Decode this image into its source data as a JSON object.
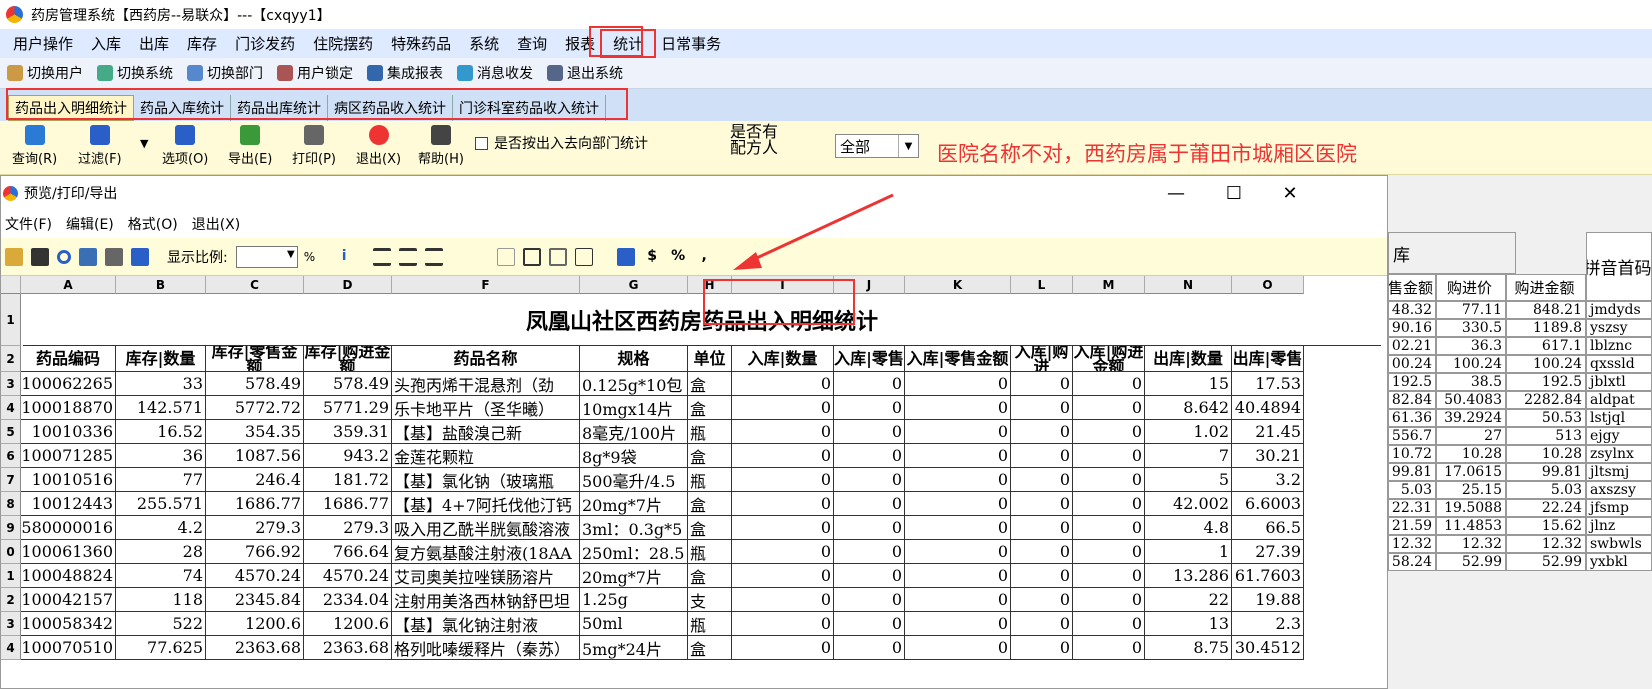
{
  "window_title": "药房管理系统【西药房--易联众】---【cxqyy1】",
  "menu": [
    "用户操作",
    "入库",
    "出库",
    "库存",
    "门诊发药",
    "住院摆药",
    "特殊药品",
    "系统",
    "查询",
    "报表",
    "统计",
    "日常事务"
  ],
  "toolbar": [
    "切换用户",
    "切换系统",
    "切换部门",
    "用户锁定",
    "集成报表",
    "消息收发",
    "退出系统"
  ],
  "tabs": [
    "药品出入明细统计",
    "药品入库统计",
    "药品出库统计",
    "病区药品收入统计",
    "门诊科室药品收入统计"
  ],
  "actions": [
    "查询(R)",
    "过滤(F)",
    "选项(O)",
    "导出(E)",
    "打印(P)",
    "退出(X)",
    "帮助(H)"
  ],
  "checkbox_label": "是否按出入去向部门统计",
  "prescriber_label_1": "是否有",
  "prescriber_label_2": "配方人",
  "prescriber_value": "全部",
  "annotation": "医院名称不对，西药房属于莆田市城厢区医院",
  "preview": {
    "title": "预览/打印/导出",
    "menu": [
      "文件(F)",
      "编辑(E)",
      "格式(O)",
      "退出(X)"
    ],
    "zoom_label": "显示比例:",
    "zoom_unit": "%",
    "report_title_a": "凤凰山社区",
    "report_title_b": "西药房药品出入明细统计",
    "col_letters": [
      "A",
      "B",
      "C",
      "D",
      "F",
      "G",
      "H",
      "I",
      "J",
      "K",
      "L",
      "M",
      "N",
      "O"
    ],
    "row_numbers": [
      "1",
      "2",
      "3",
      "4",
      "5",
      "6",
      "7",
      "8",
      "9",
      "0",
      "1",
      "2",
      "3",
      "4"
    ],
    "headers": [
      "药品编码",
      "库存|数量",
      "库存|零售金额",
      "库存|购进金额",
      "药品名称",
      "规格",
      "单位",
      "入库|数量",
      "入库|零售",
      "入库|零售金额",
      "入库|购进",
      "入库|购进金额",
      "出库|数量",
      "出库|零售"
    ],
    "rows": [
      [
        "100062265",
        "33",
        "578.49",
        "578.49",
        "头孢丙烯干混悬剂（劲",
        "0.125g*10包",
        "盒",
        "0",
        "0",
        "0",
        "0",
        "0",
        "15",
        "17.53"
      ],
      [
        "100018870",
        "142.571",
        "5772.72",
        "5771.29",
        "乐卡地平片（圣华曦）",
        "10mgx14片",
        "盒",
        "0",
        "0",
        "0",
        "0",
        "0",
        "8.642",
        "40.4894"
      ],
      [
        "10010336",
        "16.52",
        "354.35",
        "359.31",
        "【基】盐酸溴己新",
        "8毫克/100片",
        "瓶",
        "0",
        "0",
        "0",
        "0",
        "0",
        "1.02",
        "21.45"
      ],
      [
        "100071285",
        "36",
        "1087.56",
        "943.2",
        "金莲花颗粒",
        "8g*9袋",
        "盒",
        "0",
        "0",
        "0",
        "0",
        "0",
        "7",
        "30.21"
      ],
      [
        "10010516",
        "77",
        "246.4",
        "181.72",
        "【基】氯化钠（玻璃瓶",
        "500毫升/4.5",
        "瓶",
        "0",
        "0",
        "0",
        "0",
        "0",
        "5",
        "3.2"
      ],
      [
        "10012443",
        "255.571",
        "1686.77",
        "1686.77",
        "【基】4+7阿托伐他汀钙",
        "20mg*7片",
        "盒",
        "0",
        "0",
        "0",
        "0",
        "0",
        "42.002",
        "6.6003"
      ],
      [
        "0580000016",
        "4.2",
        "279.3",
        "279.3",
        "吸入用乙酰半胱氨酸溶液",
        "3ml：0.3g*5",
        "盒",
        "0",
        "0",
        "0",
        "0",
        "0",
        "4.8",
        "66.5"
      ],
      [
        "100061360",
        "28",
        "766.92",
        "766.64",
        "复方氨基酸注射液(18AA",
        "250ml：28.5",
        "瓶",
        "0",
        "0",
        "0",
        "0",
        "0",
        "1",
        "27.39"
      ],
      [
        "100048824",
        "74",
        "4570.24",
        "4570.24",
        "艾司奥美拉唑镁肠溶片",
        "20mg*7片",
        "盒",
        "0",
        "0",
        "0",
        "0",
        "0",
        "13.286",
        "61.7603"
      ],
      [
        "100042157",
        "118",
        "2345.84",
        "2334.04",
        "注射用美洛西林钠舒巴坦",
        "1.25g",
        "支",
        "0",
        "0",
        "0",
        "0",
        "0",
        "22",
        "19.88"
      ],
      [
        "100058342",
        "522",
        "1200.6",
        "1200.6",
        "【基】氯化钠注射液",
        "50ml",
        "瓶",
        "0",
        "0",
        "0",
        "0",
        "0",
        "13",
        "2.3"
      ],
      [
        "100070510",
        "77.625",
        "2363.68",
        "2363.68",
        "格列吡嗪缓释片（秦苏）",
        "5mg*24片",
        "盒",
        "0",
        "0",
        "0",
        "0",
        "0",
        "8.75",
        "30.4512"
      ]
    ]
  },
  "right_panel": {
    "group": "库",
    "headers": [
      "售金额",
      "购进价",
      "购进金额",
      "拼音首码"
    ],
    "rows": [
      [
        "48.32",
        "77.11",
        "848.21",
        "jmdyds"
      ],
      [
        "90.16",
        "330.5",
        "1189.8",
        "yszsy"
      ],
      [
        "02.21",
        "36.3",
        "617.1",
        "lblznc"
      ],
      [
        "00.24",
        "100.24",
        "100.24",
        "qxssld"
      ],
      [
        "192.5",
        "38.5",
        "192.5",
        "jblxtl"
      ],
      [
        "82.84",
        "50.4083",
        "2282.84",
        "aldpat"
      ],
      [
        "61.36",
        "39.2924",
        "50.53",
        "lstjql"
      ],
      [
        "556.7",
        "27",
        "513",
        "ejgy"
      ],
      [
        "10.72",
        "10.28",
        "10.28",
        "zsylnx"
      ],
      [
        "99.81",
        "17.0615",
        "99.81",
        "jltsmj"
      ],
      [
        "5.03",
        "25.15",
        "5.03",
        "axszsy"
      ],
      [
        "22.31",
        "19.5088",
        "22.24",
        "jfsmp"
      ],
      [
        "21.59",
        "11.4853",
        "15.62",
        "jlnz"
      ],
      [
        "12.32",
        "12.32",
        "12.32",
        "swbwls"
      ],
      [
        "58.24",
        "52.99",
        "52.99",
        "yxbkl"
      ]
    ]
  },
  "colors": {
    "annotation": "#e33333",
    "menubar": "#ddeaff",
    "toolbar2": "#fffbd9"
  }
}
